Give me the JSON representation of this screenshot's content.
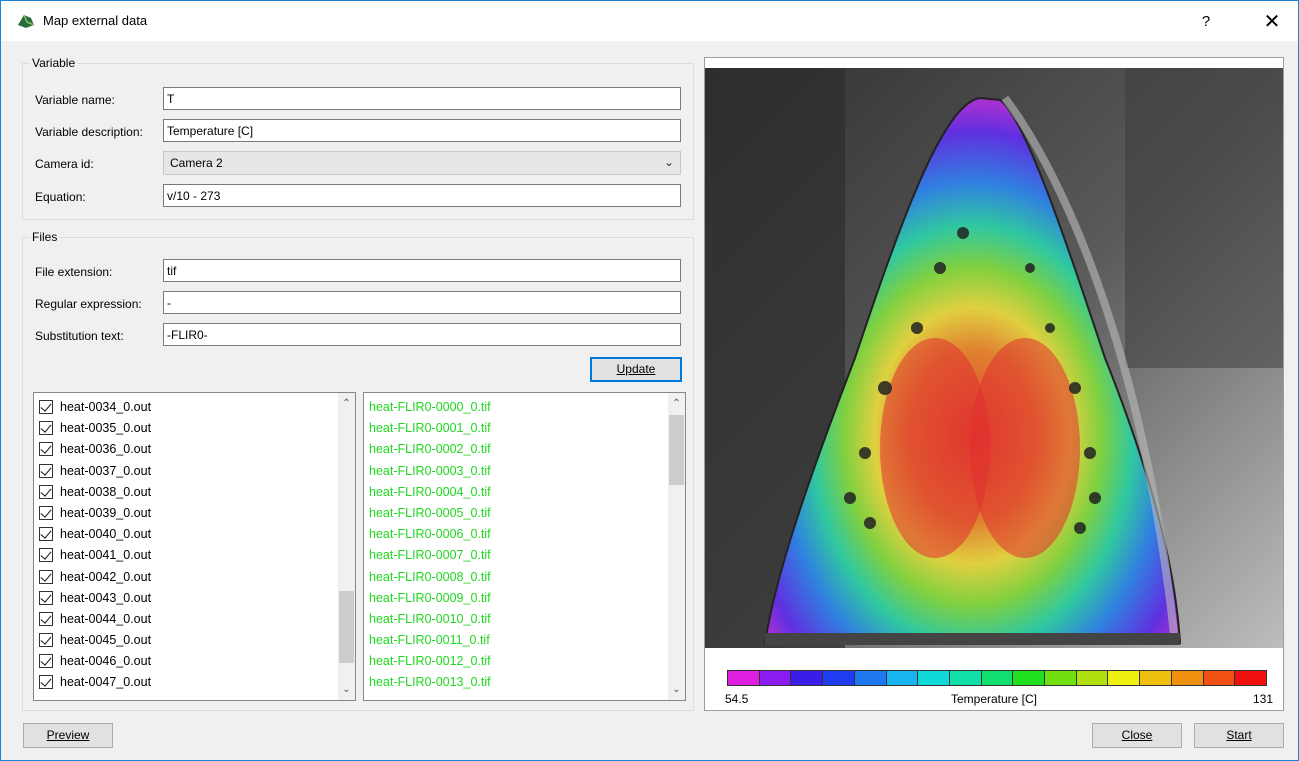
{
  "window": {
    "title": "Map external data",
    "help": "?",
    "close": "✕"
  },
  "variable": {
    "legend": "Variable",
    "name_label": "Variable name:",
    "name_value": "T",
    "desc_label": "Variable description:",
    "desc_value": "Temperature [C]",
    "camera_label": "Camera id:",
    "camera_value": "Camera 2",
    "equation_label": "Equation:",
    "equation_value": "v/10 - 273"
  },
  "files": {
    "legend": "Files",
    "ext_label": "File extension:",
    "ext_value": "tif",
    "regex_label": "Regular expression:",
    "regex_value": "-",
    "subst_label": "Substitution text:",
    "subst_value": "-FLIR0-",
    "update_button": "Update"
  },
  "left_list": [
    "heat-0034_0.out",
    "heat-0035_0.out",
    "heat-0036_0.out",
    "heat-0037_0.out",
    "heat-0038_0.out",
    "heat-0039_0.out",
    "heat-0040_0.out",
    "heat-0041_0.out",
    "heat-0042_0.out",
    "heat-0043_0.out",
    "heat-0044_0.out",
    "heat-0045_0.out",
    "heat-0046_0.out",
    "heat-0047_0.out"
  ],
  "right_list": [
    "heat-FLIR0-0000_0.tif",
    "heat-FLIR0-0001_0.tif",
    "heat-FLIR0-0002_0.tif",
    "heat-FLIR0-0003_0.tif",
    "heat-FLIR0-0004_0.tif",
    "heat-FLIR0-0005_0.tif",
    "heat-FLIR0-0006_0.tif",
    "heat-FLIR0-0007_0.tif",
    "heat-FLIR0-0008_0.tif",
    "heat-FLIR0-0009_0.tif",
    "heat-FLIR0-0010_0.tif",
    "heat-FLIR0-0011_0.tif",
    "heat-FLIR0-0012_0.tif",
    "heat-FLIR0-0013_0.tif"
  ],
  "right_list_color": "#1fd81f",
  "colorbar": {
    "min": "54.5",
    "max": "131",
    "title": "Temperature [C]",
    "colors": [
      "#e020e0",
      "#8a1cf0",
      "#3a1ee8",
      "#1e3cf0",
      "#1e78f0",
      "#18b4f0",
      "#10d8d8",
      "#10e0a8",
      "#10e070",
      "#20e020",
      "#70e010",
      "#b0e010",
      "#f0f010",
      "#f0c010",
      "#f09010",
      "#f05010",
      "#f01010"
    ]
  },
  "buttons": {
    "preview": "Preview",
    "close": "Close",
    "start": "Start"
  }
}
